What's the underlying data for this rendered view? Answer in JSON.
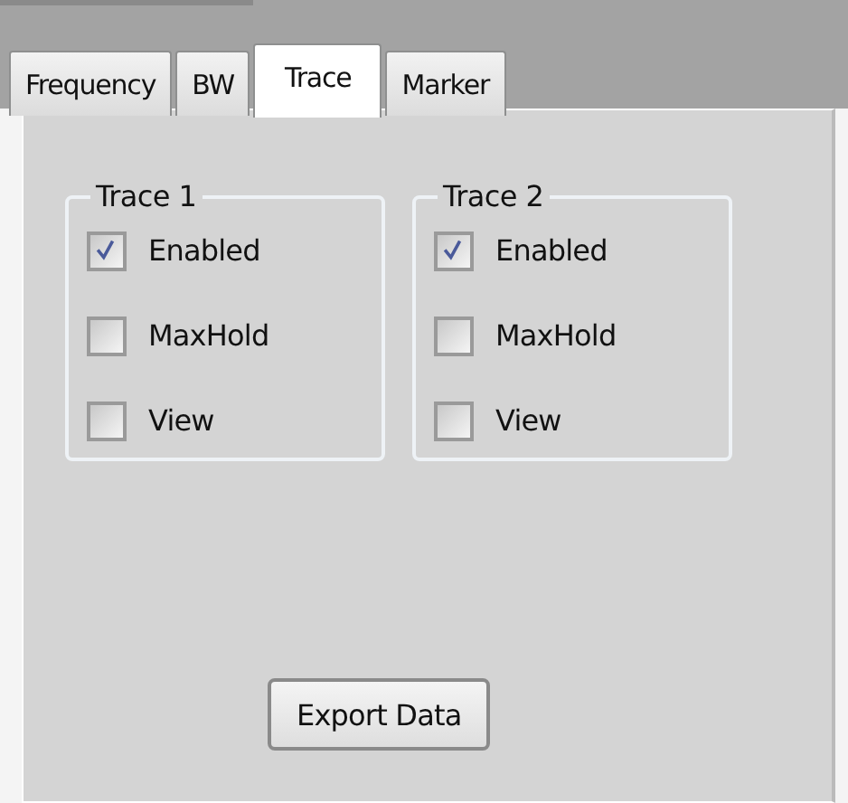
{
  "tabs": [
    {
      "label": "Frequency",
      "selected": false
    },
    {
      "label": "BW",
      "selected": false
    },
    {
      "label": "Trace",
      "selected": true
    },
    {
      "label": "Marker",
      "selected": false
    }
  ],
  "groups": [
    {
      "title": "Trace 1",
      "options": [
        {
          "label": "Enabled",
          "checked": true
        },
        {
          "label": "MaxHold",
          "checked": false
        },
        {
          "label": "View",
          "checked": false
        }
      ]
    },
    {
      "title": "Trace 2",
      "options": [
        {
          "label": "Enabled",
          "checked": true
        },
        {
          "label": "MaxHold",
          "checked": false
        },
        {
          "label": "View",
          "checked": false
        }
      ]
    }
  ],
  "buttons": [
    "Export Data"
  ]
}
